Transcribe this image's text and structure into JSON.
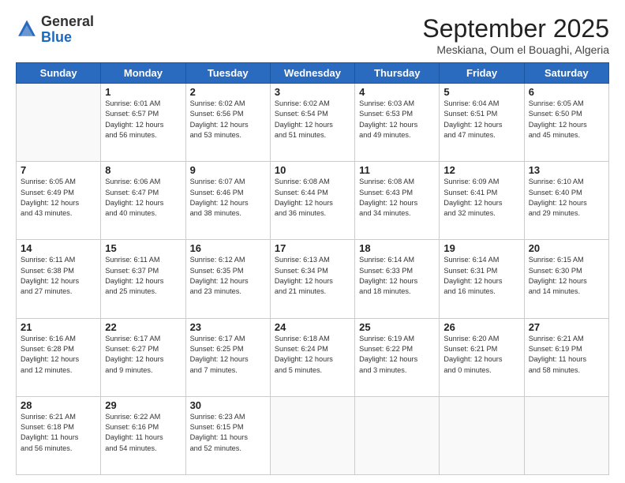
{
  "header": {
    "logo_general": "General",
    "logo_blue": "Blue",
    "month_title": "September 2025",
    "location": "Meskiana, Oum el Bouaghi, Algeria"
  },
  "days_of_week": [
    "Sunday",
    "Monday",
    "Tuesday",
    "Wednesday",
    "Thursday",
    "Friday",
    "Saturday"
  ],
  "weeks": [
    [
      {
        "day": "",
        "info": ""
      },
      {
        "day": "1",
        "info": "Sunrise: 6:01 AM\nSunset: 6:57 PM\nDaylight: 12 hours\nand 56 minutes."
      },
      {
        "day": "2",
        "info": "Sunrise: 6:02 AM\nSunset: 6:56 PM\nDaylight: 12 hours\nand 53 minutes."
      },
      {
        "day": "3",
        "info": "Sunrise: 6:02 AM\nSunset: 6:54 PM\nDaylight: 12 hours\nand 51 minutes."
      },
      {
        "day": "4",
        "info": "Sunrise: 6:03 AM\nSunset: 6:53 PM\nDaylight: 12 hours\nand 49 minutes."
      },
      {
        "day": "5",
        "info": "Sunrise: 6:04 AM\nSunset: 6:51 PM\nDaylight: 12 hours\nand 47 minutes."
      },
      {
        "day": "6",
        "info": "Sunrise: 6:05 AM\nSunset: 6:50 PM\nDaylight: 12 hours\nand 45 minutes."
      }
    ],
    [
      {
        "day": "7",
        "info": "Sunrise: 6:05 AM\nSunset: 6:49 PM\nDaylight: 12 hours\nand 43 minutes."
      },
      {
        "day": "8",
        "info": "Sunrise: 6:06 AM\nSunset: 6:47 PM\nDaylight: 12 hours\nand 40 minutes."
      },
      {
        "day": "9",
        "info": "Sunrise: 6:07 AM\nSunset: 6:46 PM\nDaylight: 12 hours\nand 38 minutes."
      },
      {
        "day": "10",
        "info": "Sunrise: 6:08 AM\nSunset: 6:44 PM\nDaylight: 12 hours\nand 36 minutes."
      },
      {
        "day": "11",
        "info": "Sunrise: 6:08 AM\nSunset: 6:43 PM\nDaylight: 12 hours\nand 34 minutes."
      },
      {
        "day": "12",
        "info": "Sunrise: 6:09 AM\nSunset: 6:41 PM\nDaylight: 12 hours\nand 32 minutes."
      },
      {
        "day": "13",
        "info": "Sunrise: 6:10 AM\nSunset: 6:40 PM\nDaylight: 12 hours\nand 29 minutes."
      }
    ],
    [
      {
        "day": "14",
        "info": "Sunrise: 6:11 AM\nSunset: 6:38 PM\nDaylight: 12 hours\nand 27 minutes."
      },
      {
        "day": "15",
        "info": "Sunrise: 6:11 AM\nSunset: 6:37 PM\nDaylight: 12 hours\nand 25 minutes."
      },
      {
        "day": "16",
        "info": "Sunrise: 6:12 AM\nSunset: 6:35 PM\nDaylight: 12 hours\nand 23 minutes."
      },
      {
        "day": "17",
        "info": "Sunrise: 6:13 AM\nSunset: 6:34 PM\nDaylight: 12 hours\nand 21 minutes."
      },
      {
        "day": "18",
        "info": "Sunrise: 6:14 AM\nSunset: 6:33 PM\nDaylight: 12 hours\nand 18 minutes."
      },
      {
        "day": "19",
        "info": "Sunrise: 6:14 AM\nSunset: 6:31 PM\nDaylight: 12 hours\nand 16 minutes."
      },
      {
        "day": "20",
        "info": "Sunrise: 6:15 AM\nSunset: 6:30 PM\nDaylight: 12 hours\nand 14 minutes."
      }
    ],
    [
      {
        "day": "21",
        "info": "Sunrise: 6:16 AM\nSunset: 6:28 PM\nDaylight: 12 hours\nand 12 minutes."
      },
      {
        "day": "22",
        "info": "Sunrise: 6:17 AM\nSunset: 6:27 PM\nDaylight: 12 hours\nand 9 minutes."
      },
      {
        "day": "23",
        "info": "Sunrise: 6:17 AM\nSunset: 6:25 PM\nDaylight: 12 hours\nand 7 minutes."
      },
      {
        "day": "24",
        "info": "Sunrise: 6:18 AM\nSunset: 6:24 PM\nDaylight: 12 hours\nand 5 minutes."
      },
      {
        "day": "25",
        "info": "Sunrise: 6:19 AM\nSunset: 6:22 PM\nDaylight: 12 hours\nand 3 minutes."
      },
      {
        "day": "26",
        "info": "Sunrise: 6:20 AM\nSunset: 6:21 PM\nDaylight: 12 hours\nand 0 minutes."
      },
      {
        "day": "27",
        "info": "Sunrise: 6:21 AM\nSunset: 6:19 PM\nDaylight: 11 hours\nand 58 minutes."
      }
    ],
    [
      {
        "day": "28",
        "info": "Sunrise: 6:21 AM\nSunset: 6:18 PM\nDaylight: 11 hours\nand 56 minutes."
      },
      {
        "day": "29",
        "info": "Sunrise: 6:22 AM\nSunset: 6:16 PM\nDaylight: 11 hours\nand 54 minutes."
      },
      {
        "day": "30",
        "info": "Sunrise: 6:23 AM\nSunset: 6:15 PM\nDaylight: 11 hours\nand 52 minutes."
      },
      {
        "day": "",
        "info": ""
      },
      {
        "day": "",
        "info": ""
      },
      {
        "day": "",
        "info": ""
      },
      {
        "day": "",
        "info": ""
      }
    ]
  ]
}
